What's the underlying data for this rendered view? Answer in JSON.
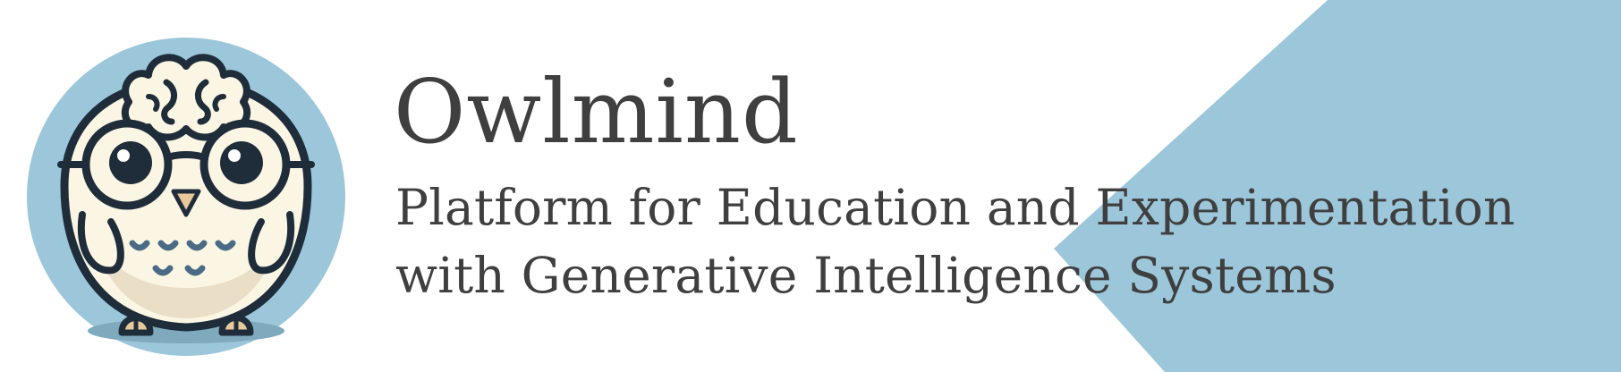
{
  "brand": {
    "name": "Owlmind",
    "tagline_line1": "Platform for Education and Experimentation",
    "tagline_line2": "with Generative Intelligence Systems"
  },
  "logo": {
    "icon": "owl-with-brain-icon"
  },
  "colors": {
    "background": "#ffffff",
    "accent_blue": "#9cc7db",
    "text": "#3f3f3f",
    "owl_body": "#fbf6e4",
    "owl_outline": "#1f2d3a"
  }
}
